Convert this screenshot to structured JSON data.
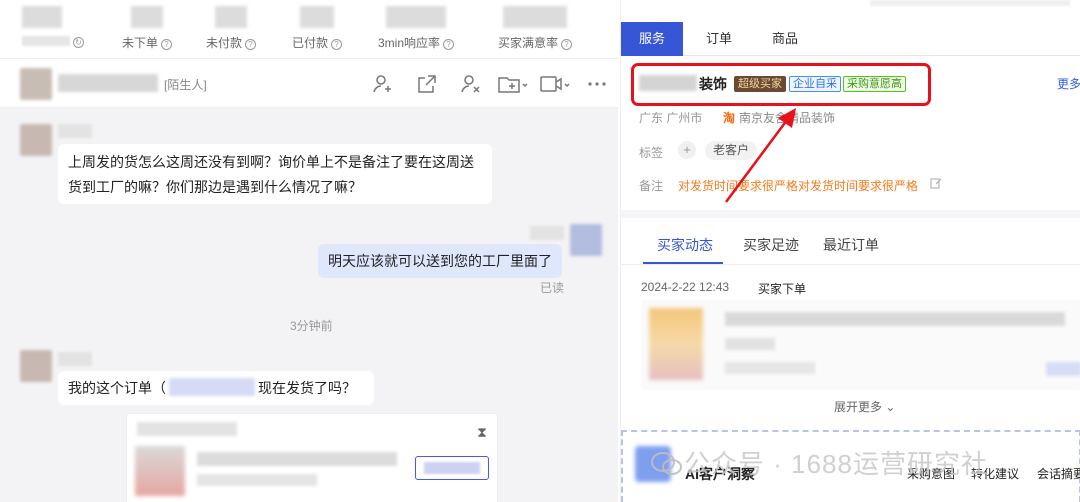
{
  "stats": [
    {
      "label": "",
      "help": false
    },
    {
      "label": "未下单",
      "help": true
    },
    {
      "label": "未付款",
      "help": true
    },
    {
      "label": "已付款",
      "help": true
    },
    {
      "label": "3min响应率",
      "help": true
    },
    {
      "label": "买家满意率",
      "help": true
    }
  ],
  "chat": {
    "header_tag": "[陌生人]",
    "messages": [
      {
        "from": "buyer",
        "text_line1": "上周发的货怎么这周还没有到啊？询价单上不是备注了要在这周送",
        "text_line2": "货到工厂的嘛？你们那边是遇到什么情况了嘛？"
      },
      {
        "from": "seller",
        "text": "明天应该就可以送到您的工厂里面了",
        "status": "已读"
      },
      {
        "from": "buyer",
        "text_before": "我的这个订单（",
        "text_after": "现在发货了吗？"
      }
    ],
    "time_divider": "3分钟前"
  },
  "right": {
    "tabs": [
      "服务",
      "订单",
      "商品"
    ],
    "active_tab": "服务",
    "buyer": {
      "name_suffix": "装饰",
      "badges": [
        "超级买家",
        "企业自采",
        "采购意愿高"
      ],
      "more": "更多",
      "location": "广东 广州市",
      "shop_icon": "淘",
      "shop": "南京友舍精品装饰",
      "tag_label": "标签",
      "tag_add": "+",
      "tags": [
        "老客户"
      ],
      "note_label": "备注",
      "note": "对发货时间要求很严格对发货时间要求很严格"
    },
    "activity_tabs": [
      "买家动态",
      "买家足迹",
      "最近订单"
    ],
    "activity": {
      "date": "2024-2-22  12:43",
      "event": "买家下单"
    },
    "expand": "展开更多",
    "ai": {
      "title": "AI客户洞察",
      "chips": [
        "采购意图",
        "转化建议",
        "会话摘要"
      ]
    }
  },
  "watermark": "公众号 · 1688运营研究社",
  "colors": {
    "accent": "#3756d6",
    "highlight": "#e8101a",
    "note": "#f07c1c"
  }
}
